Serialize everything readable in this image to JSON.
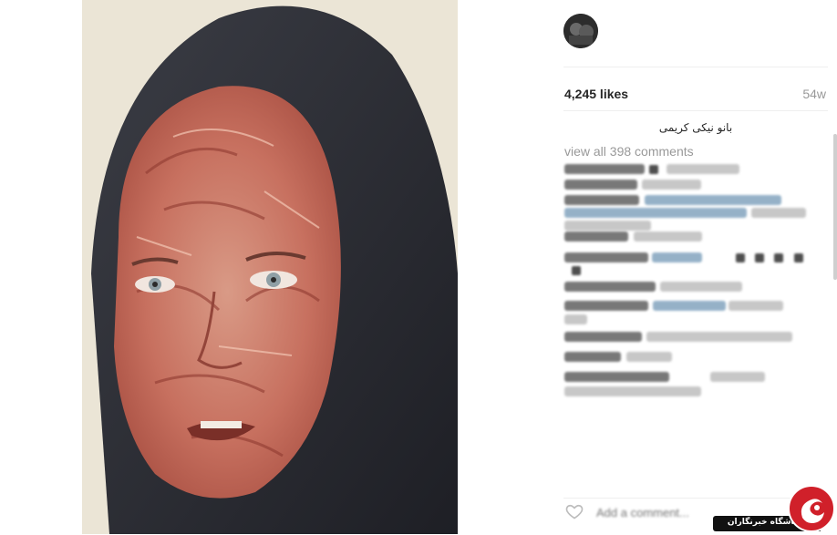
{
  "post": {
    "image_alt": "portrait of woman in dark headscarf with burn makeup",
    "likes": "4,245 likes",
    "age": "54w",
    "caption": "بانو نیکی کریمی",
    "view_all_comments": "view all 398 comments",
    "add_comment_placeholder": "Add a comment..."
  },
  "icons": {
    "avatar": "user-avatar",
    "like": "heart-icon"
  },
  "watermark": {
    "text": "باشگاه خبرنگاران"
  },
  "colors": {
    "link_blue": "#3f729b",
    "muted_grey": "#999999",
    "watermark_red": "#d0202a"
  }
}
